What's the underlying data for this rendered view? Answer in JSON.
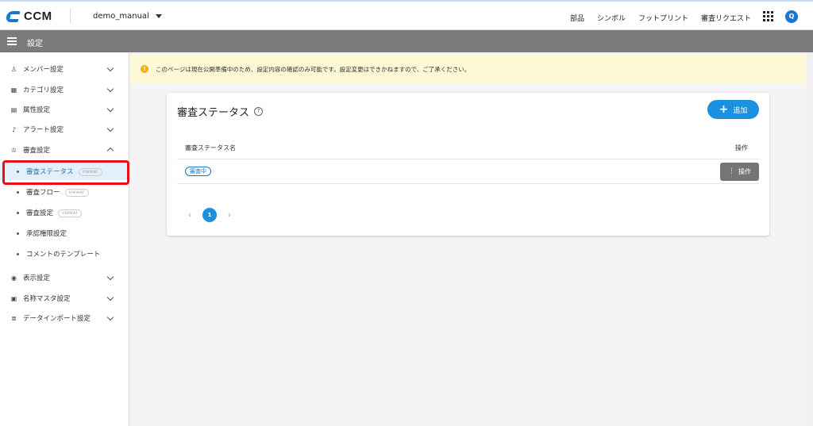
{
  "app": {
    "logo": "CCM",
    "project": "demo_manual",
    "user_initial": "Q"
  },
  "topnav": [
    "部品",
    "シンボル",
    "フットプリント",
    "審査リクエスト"
  ],
  "subbar": {
    "title": "設定"
  },
  "sidebar": {
    "items": [
      {
        "label": "メンバー設定",
        "icon": "person-icon",
        "glyph": "♙"
      },
      {
        "label": "カテゴリ設定",
        "icon": "category-icon",
        "glyph": "▦"
      },
      {
        "label": "属性設定",
        "icon": "document-icon",
        "glyph": "▤"
      },
      {
        "label": "アラート設定",
        "icon": "bell-icon",
        "glyph": "♪"
      },
      {
        "label": "審査設定",
        "icon": "stamp-icon",
        "glyph": "♔"
      },
      {
        "label": "表示設定",
        "icon": "eye-icon",
        "glyph": "◉"
      },
      {
        "label": "名称マスタ設定",
        "icon": "table-icon",
        "glyph": "▣"
      },
      {
        "label": "データインポート設定",
        "icon": "database-icon",
        "glyph": "≣"
      }
    ],
    "sub_items": [
      {
        "label": "審査ステータス",
        "badge": "viewer"
      },
      {
        "label": "審査フロー",
        "badge": "viewer"
      },
      {
        "label": "審査設定",
        "badge": "viewer"
      },
      {
        "label": "承認権限設定",
        "badge": ""
      },
      {
        "label": "コメントのテンプレート",
        "badge": ""
      }
    ]
  },
  "alert": {
    "icon": "!",
    "text": "このページは現在公開準備中のため、設定内容の確認のみ可能です。設定変更はできかねますので、ご了承ください。"
  },
  "card": {
    "title": "審査ステータス",
    "help": "?",
    "add_label": "追加",
    "add_symbol": "+",
    "columns": {
      "name": "審査ステータス名",
      "ops": "操作"
    },
    "rows": [
      {
        "status": "審査中",
        "op_label": "操作"
      }
    ],
    "pagination": {
      "prev": "‹",
      "current": "1",
      "next": "›"
    }
  },
  "colors": {
    "accent": "#1a90e0",
    "highlight": "#e3121b",
    "alert_bg": "#fdf8d5",
    "subbar": "#7b7b7b"
  }
}
